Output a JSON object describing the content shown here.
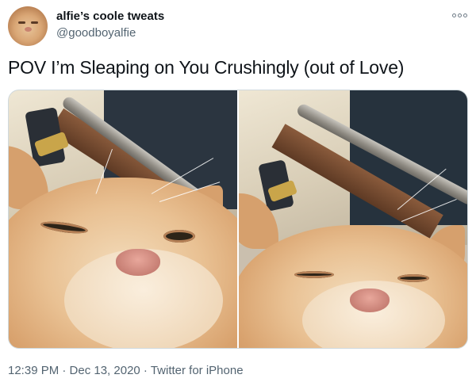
{
  "user": {
    "display_name": "alfie’s coole tweats",
    "handle": "@goodboyalfie"
  },
  "tweet": {
    "text": "POV I’m Sleaping on You Crushingly (out of Love)",
    "timestamp": "12:39 PM · Dec 13, 2020 · Twitter for iPhone"
  },
  "icons": {
    "more": "more-options-icon"
  },
  "colors": {
    "text_primary": "#0f1419",
    "text_secondary": "#536471",
    "media_border": "#cfd9de"
  }
}
